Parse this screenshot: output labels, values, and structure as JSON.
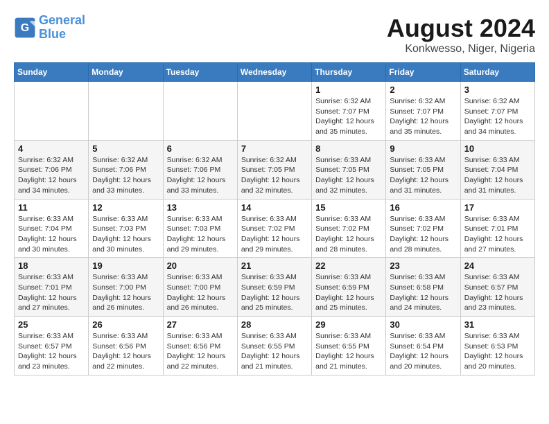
{
  "header": {
    "logo_line1": "General",
    "logo_line2": "Blue",
    "month_title": "August 2024",
    "location": "Konkwesso, Niger, Nigeria"
  },
  "days_of_week": [
    "Sunday",
    "Monday",
    "Tuesday",
    "Wednesday",
    "Thursday",
    "Friday",
    "Saturday"
  ],
  "weeks": [
    [
      {
        "day": "",
        "info": ""
      },
      {
        "day": "",
        "info": ""
      },
      {
        "day": "",
        "info": ""
      },
      {
        "day": "",
        "info": ""
      },
      {
        "day": "1",
        "info": "Sunrise: 6:32 AM\nSunset: 7:07 PM\nDaylight: 12 hours\nand 35 minutes."
      },
      {
        "day": "2",
        "info": "Sunrise: 6:32 AM\nSunset: 7:07 PM\nDaylight: 12 hours\nand 35 minutes."
      },
      {
        "day": "3",
        "info": "Sunrise: 6:32 AM\nSunset: 7:07 PM\nDaylight: 12 hours\nand 34 minutes."
      }
    ],
    [
      {
        "day": "4",
        "info": "Sunrise: 6:32 AM\nSunset: 7:06 PM\nDaylight: 12 hours\nand 34 minutes."
      },
      {
        "day": "5",
        "info": "Sunrise: 6:32 AM\nSunset: 7:06 PM\nDaylight: 12 hours\nand 33 minutes."
      },
      {
        "day": "6",
        "info": "Sunrise: 6:32 AM\nSunset: 7:06 PM\nDaylight: 12 hours\nand 33 minutes."
      },
      {
        "day": "7",
        "info": "Sunrise: 6:32 AM\nSunset: 7:05 PM\nDaylight: 12 hours\nand 32 minutes."
      },
      {
        "day": "8",
        "info": "Sunrise: 6:33 AM\nSunset: 7:05 PM\nDaylight: 12 hours\nand 32 minutes."
      },
      {
        "day": "9",
        "info": "Sunrise: 6:33 AM\nSunset: 7:05 PM\nDaylight: 12 hours\nand 31 minutes."
      },
      {
        "day": "10",
        "info": "Sunrise: 6:33 AM\nSunset: 7:04 PM\nDaylight: 12 hours\nand 31 minutes."
      }
    ],
    [
      {
        "day": "11",
        "info": "Sunrise: 6:33 AM\nSunset: 7:04 PM\nDaylight: 12 hours\nand 30 minutes."
      },
      {
        "day": "12",
        "info": "Sunrise: 6:33 AM\nSunset: 7:03 PM\nDaylight: 12 hours\nand 30 minutes."
      },
      {
        "day": "13",
        "info": "Sunrise: 6:33 AM\nSunset: 7:03 PM\nDaylight: 12 hours\nand 29 minutes."
      },
      {
        "day": "14",
        "info": "Sunrise: 6:33 AM\nSunset: 7:02 PM\nDaylight: 12 hours\nand 29 minutes."
      },
      {
        "day": "15",
        "info": "Sunrise: 6:33 AM\nSunset: 7:02 PM\nDaylight: 12 hours\nand 28 minutes."
      },
      {
        "day": "16",
        "info": "Sunrise: 6:33 AM\nSunset: 7:02 PM\nDaylight: 12 hours\nand 28 minutes."
      },
      {
        "day": "17",
        "info": "Sunrise: 6:33 AM\nSunset: 7:01 PM\nDaylight: 12 hours\nand 27 minutes."
      }
    ],
    [
      {
        "day": "18",
        "info": "Sunrise: 6:33 AM\nSunset: 7:01 PM\nDaylight: 12 hours\nand 27 minutes."
      },
      {
        "day": "19",
        "info": "Sunrise: 6:33 AM\nSunset: 7:00 PM\nDaylight: 12 hours\nand 26 minutes."
      },
      {
        "day": "20",
        "info": "Sunrise: 6:33 AM\nSunset: 7:00 PM\nDaylight: 12 hours\nand 26 minutes."
      },
      {
        "day": "21",
        "info": "Sunrise: 6:33 AM\nSunset: 6:59 PM\nDaylight: 12 hours\nand 25 minutes."
      },
      {
        "day": "22",
        "info": "Sunrise: 6:33 AM\nSunset: 6:59 PM\nDaylight: 12 hours\nand 25 minutes."
      },
      {
        "day": "23",
        "info": "Sunrise: 6:33 AM\nSunset: 6:58 PM\nDaylight: 12 hours\nand 24 minutes."
      },
      {
        "day": "24",
        "info": "Sunrise: 6:33 AM\nSunset: 6:57 PM\nDaylight: 12 hours\nand 23 minutes."
      }
    ],
    [
      {
        "day": "25",
        "info": "Sunrise: 6:33 AM\nSunset: 6:57 PM\nDaylight: 12 hours\nand 23 minutes."
      },
      {
        "day": "26",
        "info": "Sunrise: 6:33 AM\nSunset: 6:56 PM\nDaylight: 12 hours\nand 22 minutes."
      },
      {
        "day": "27",
        "info": "Sunrise: 6:33 AM\nSunset: 6:56 PM\nDaylight: 12 hours\nand 22 minutes."
      },
      {
        "day": "28",
        "info": "Sunrise: 6:33 AM\nSunset: 6:55 PM\nDaylight: 12 hours\nand 21 minutes."
      },
      {
        "day": "29",
        "info": "Sunrise: 6:33 AM\nSunset: 6:55 PM\nDaylight: 12 hours\nand 21 minutes."
      },
      {
        "day": "30",
        "info": "Sunrise: 6:33 AM\nSunset: 6:54 PM\nDaylight: 12 hours\nand 20 minutes."
      },
      {
        "day": "31",
        "info": "Sunrise: 6:33 AM\nSunset: 6:53 PM\nDaylight: 12 hours\nand 20 minutes."
      }
    ]
  ]
}
